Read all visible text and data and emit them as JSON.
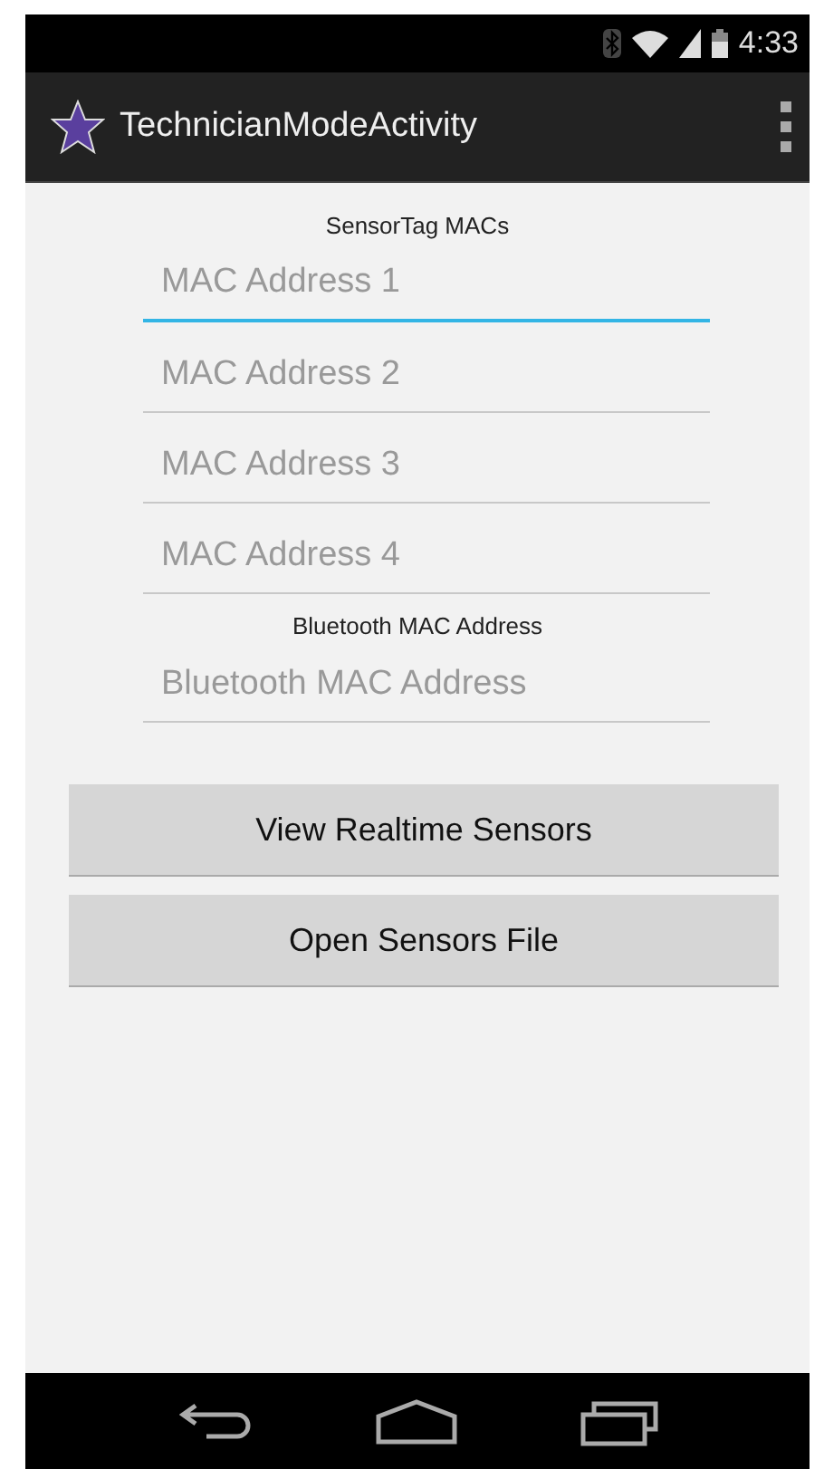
{
  "status_bar": {
    "time": "4:33"
  },
  "action_bar": {
    "title": "TechnicianModeActivity"
  },
  "sections": [
    {
      "label": "SensorTag MACs",
      "fields": [
        {
          "placeholder": "MAC Address 1",
          "focused": true
        },
        {
          "placeholder": "MAC Address 2",
          "focused": false
        },
        {
          "placeholder": "MAC Address 3",
          "focused": false
        },
        {
          "placeholder": "MAC Address 4",
          "focused": false
        }
      ]
    },
    {
      "label": "Bluetooth MAC Address",
      "fields": [
        {
          "placeholder": "Bluetooth MAC Address",
          "focused": false
        }
      ]
    }
  ],
  "buttons": [
    "View Realtime Sensors",
    "Open Sensors File"
  ]
}
